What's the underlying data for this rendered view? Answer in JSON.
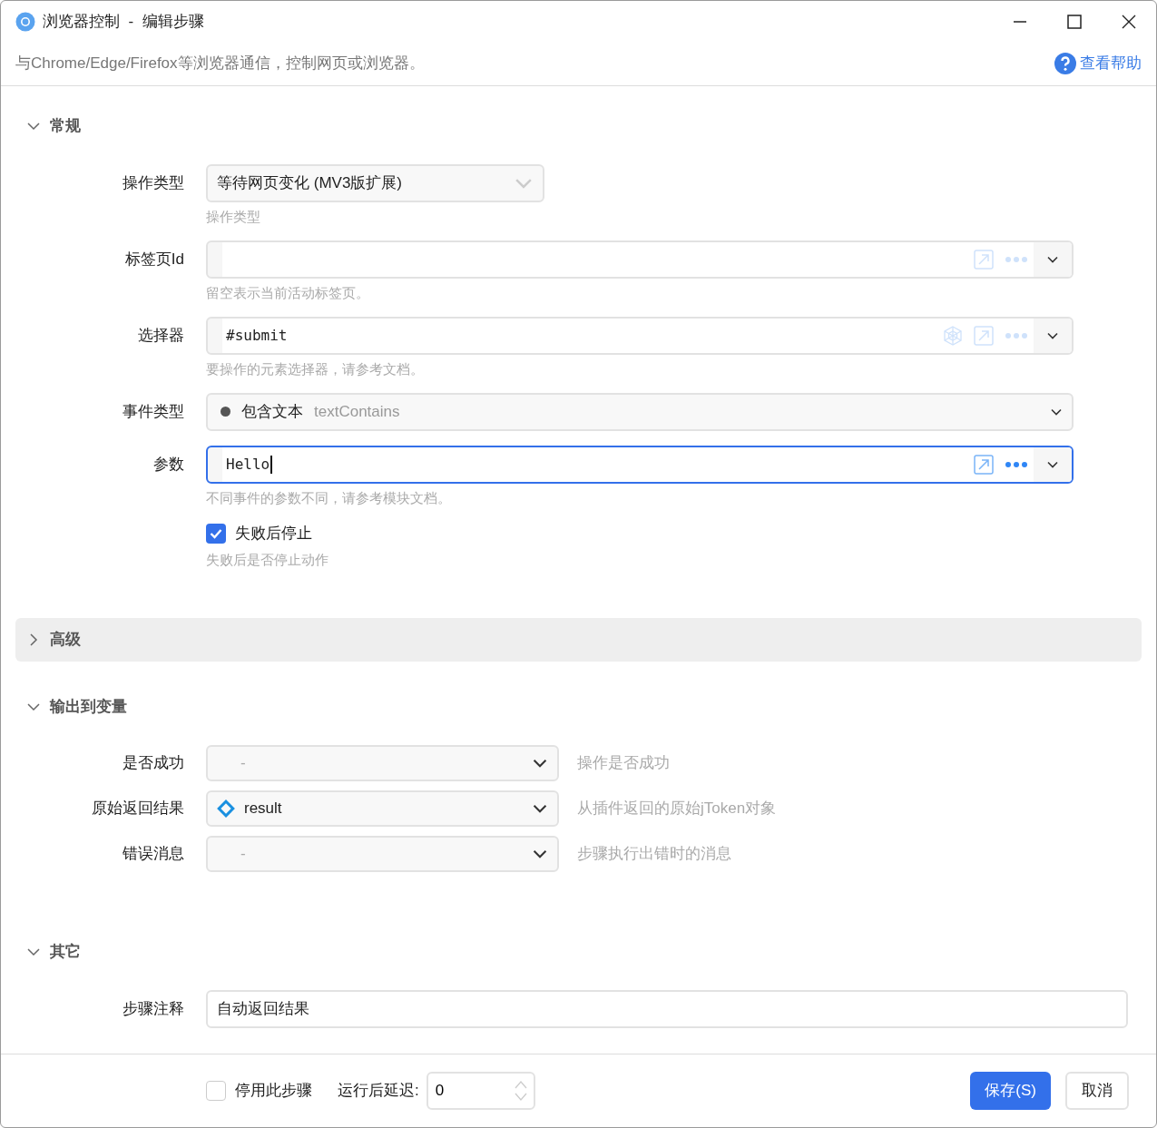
{
  "window": {
    "title": "浏览器控制  -  编辑步骤",
    "description": "与Chrome/Edge/Firefox等浏览器通信，控制网页或浏览器。",
    "help_link": "查看帮助"
  },
  "sections": [
    {
      "title": "常规",
      "expanded": true,
      "fields": [
        {
          "kind": "select",
          "label": "操作类型",
          "value": "等待网页变化 (MV3版扩展)",
          "hint": "操作类型"
        },
        {
          "kind": "expression",
          "label": "标签页Id",
          "hint": "留空表示当前活动标签页。",
          "focused": false,
          "picker": false
        },
        {
          "kind": "expression",
          "label": "选择器",
          "value": "#submit",
          "hint": "要操作的元素选择器，请参考文档。",
          "focused": false,
          "picker": true
        },
        {
          "kind": "event",
          "label": "事件类型",
          "value": "包含文本",
          "code": "textContains"
        },
        {
          "kind": "expression",
          "label": "参数",
          "value": "Hello",
          "hint": "不同事件的参数不同，请参考模块文档。",
          "focused": true,
          "picker": false
        },
        {
          "kind": "checkbox",
          "label": "失败后停止",
          "checked": true,
          "hint": "失败后是否停止动作"
        }
      ]
    },
    {
      "title": "高级",
      "expanded": false
    },
    {
      "title": "输出到变量",
      "expanded": true,
      "fields": [
        {
          "kind": "output",
          "label": "是否成功",
          "placeholder": "-",
          "hint": "操作是否成功"
        },
        {
          "kind": "output",
          "label": "原始返回结果",
          "value": "result",
          "hint": "从插件返回的原始jToken对象"
        },
        {
          "kind": "output",
          "label": "错误消息",
          "placeholder": "-",
          "hint": "步骤执行出错时的消息"
        }
      ]
    },
    {
      "title": "其它",
      "expanded": true,
      "fields": [
        {
          "kind": "text",
          "label": "步骤注释",
          "value": "自动返回结果"
        }
      ]
    }
  ],
  "footer": {
    "disable": {
      "label": "停用此步骤",
      "checked": false
    },
    "delay": {
      "label": "运行后延迟:",
      "value": "0"
    },
    "buttons": [
      {
        "label": "保存(S)",
        "primary": true
      },
      {
        "label": "取消",
        "primary": false
      }
    ]
  }
}
